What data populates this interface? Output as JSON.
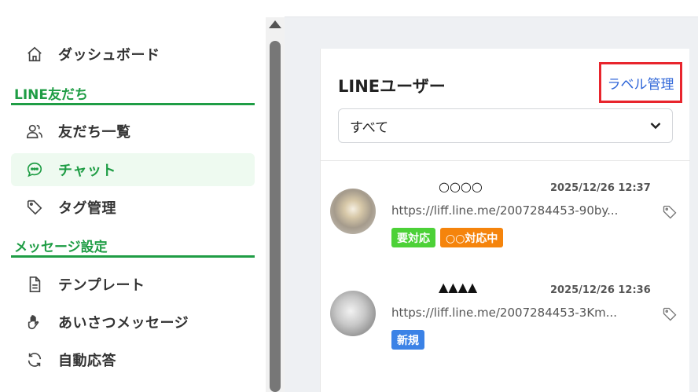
{
  "sidebar": {
    "items": [
      {
        "label": "ダッシュボード",
        "icon": "home-icon"
      },
      {
        "label": "友だち一覧",
        "icon": "users-icon"
      },
      {
        "label": "チャット",
        "icon": "chat-icon",
        "active": true
      },
      {
        "label": "タグ管理",
        "icon": "tag-icon"
      },
      {
        "label": "テンプレート",
        "icon": "document-icon"
      },
      {
        "label": "あいさつメッセージ",
        "icon": "hand-icon"
      },
      {
        "label": "自動応答",
        "icon": "refresh-icon"
      }
    ],
    "sections": [
      {
        "label": "LINE友だち"
      },
      {
        "label": "メッセージ設定"
      }
    ]
  },
  "panel": {
    "title": "LINEユーザー",
    "label_manage": "ラベル管理",
    "filter": {
      "selected": "すべて"
    }
  },
  "users": [
    {
      "name": "○○○○",
      "date": "2025/12/26 12:37",
      "message": "https://liff.line.me/2007284453-90by...",
      "tags": [
        {
          "label": "要対応",
          "color": "#4cd137"
        },
        {
          "label": "○○対応中",
          "color": "#f5840c"
        }
      ]
    },
    {
      "name": "▲▲▲▲",
      "date": "2025/12/26 12:36",
      "message": "https://liff.line.me/2007284453-3Km...",
      "tags": [
        {
          "label": "新規",
          "color": "#3b82e6"
        }
      ]
    }
  ],
  "colors": {
    "accent_green": "#1f9d45",
    "link_blue": "#2f66d8",
    "highlight_red": "#e8252d"
  }
}
